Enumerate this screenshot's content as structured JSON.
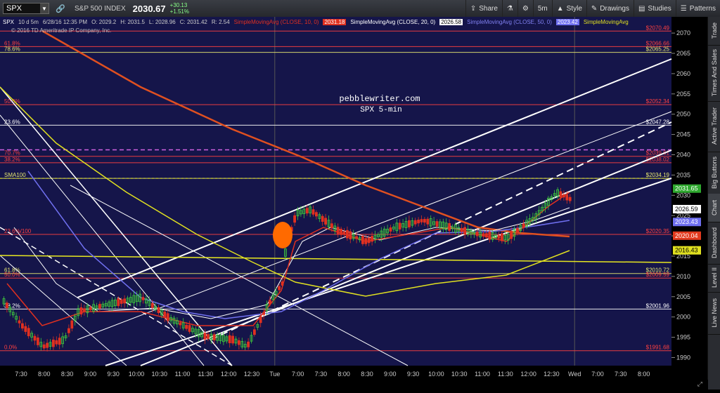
{
  "toolbar": {
    "symbol": "SPX",
    "index_name": "S&P 500 INDEX",
    "price": "2030.67",
    "change": "+30.13",
    "change_pct": "+1.51%",
    "share": "Share",
    "interval": "5m",
    "style": "Style",
    "drawings": "Drawings",
    "studies": "Studies",
    "patterns": "Patterns"
  },
  "legend": {
    "symbol": "SPX",
    "period": "10 d 5m",
    "date": "6/28/16 12:35 PM",
    "open": "O: 2029.2",
    "high": "H: 2031.5",
    "low": "L: 2028.96",
    "close": "C: 2031.42",
    "range": "R: 2.54",
    "sma10_label": "SimpleMovingAvg (CLOSE, 10, 0)",
    "sma10_val": "2031.18",
    "sma20_label": "SimpleMovingAvg (CLOSE, 20, 0)",
    "sma20_val": "2026.58",
    "sma50_label": "SimpleMovingAvg (CLOSE, 50, 0)",
    "sma50_val": "2023.42",
    "sma_extra_label": "SimpleMovingAvg",
    "copyright": "© 2016 TD Ameritrade IP Company, Inc."
  },
  "watermark": {
    "site": "pebblewriter.com",
    "subtitle": "SPX 5-min"
  },
  "right_tabs": [
    "Trade",
    "Times And Sales",
    "Active Trader",
    "Big Buttons",
    "Chart",
    "Dashboard",
    "Level II",
    "Live News"
  ],
  "axis": {
    "y_ticks": [
      "2070",
      "2065",
      "2060",
      "2055",
      "2050",
      "2045",
      "2040",
      "2035",
      "2030",
      "2025",
      "2020",
      "2015",
      "2010",
      "2005",
      "2000",
      "1995",
      "1990"
    ],
    "x_ticks": [
      "7:30",
      "8:00",
      "8:30",
      "9:00",
      "9:30",
      "10:00",
      "10:30",
      "11:00",
      "11:30",
      "12:00",
      "12:30",
      "Tue",
      "7:00",
      "7:30",
      "8:00",
      "8:30",
      "9:00",
      "9:30",
      "10:00",
      "10:30",
      "11:00",
      "11:30",
      "12:00",
      "12:30",
      "Wed",
      "7:00",
      "7:30",
      "8:00"
    ]
  },
  "fib_levels": [
    {
      "pct": "61.8%",
      "price": "$2066.66",
      "color": "#ff4040"
    },
    {
      "pct": "78.6%",
      "price": "$2065.25",
      "color": "#e8e870"
    },
    {
      "pct": "50.0%",
      "price": "$2052.34",
      "color": "#ff4040"
    },
    {
      "pct": "23.6%",
      "price": "$2047.28",
      "color": "#ffffff"
    },
    {
      "pct": "70.7%",
      "price": "$2039.61",
      "color": "#ff4040"
    },
    {
      "pct": "38.2%",
      "price": "$2038.02",
      "color": "#ff4040"
    },
    {
      "pct": "SMA100",
      "price": "$2034.19",
      "color": "#e8e870"
    },
    {
      "pct": "23.6%/100",
      "price": "$2020.35",
      "color": "#ff4040"
    },
    {
      "pct": "61.8%",
      "price": "$2010.72",
      "color": "#e8e870"
    },
    {
      "pct": "50.0%",
      "price": "$2009.59",
      "color": "#ff4040"
    },
    {
      "pct": "38.2%",
      "price": "$2001.96",
      "color": "#ffffff"
    },
    {
      "pct": "0.0%",
      "price": "$1991.68",
      "color": "#ff4040"
    },
    {
      "pct": "",
      "price": "$2070.49",
      "color": "#ff4040"
    }
  ],
  "price_badges": [
    {
      "text": "2031.65",
      "bg": "#2ea82e",
      "fg": "#ffffff",
      "value": 2031.65
    },
    {
      "text": "2026.59",
      "bg": "#ffffff",
      "fg": "#000000",
      "value": 2026.59
    },
    {
      "text": "2023.43",
      "bg": "#6f6ff0",
      "fg": "#ffffff",
      "value": 2023.43
    },
    {
      "text": "2020.04",
      "bg": "#e23a1e",
      "fg": "#ffffff",
      "value": 2020.04
    },
    {
      "text": "2016.43",
      "bg": "#e0e020",
      "fg": "#000000",
      "value": 2016.43
    }
  ],
  "colors": {
    "chart_bg": "#15154a",
    "axis_bg": "#000000",
    "up_candle": "#3ec83e",
    "down_candle": "#e03020",
    "sma10": "#e03020",
    "sma20": "#ffffff",
    "sma50": "#7070f0",
    "sma100": "#e0e020",
    "sma200": "#e05020",
    "channel": "#ffffff",
    "marker": "#ff6a00"
  },
  "chart_data": {
    "type": "candlestick",
    "price_range": [
      1988,
      2074
    ],
    "last_price": 2031.42
  }
}
